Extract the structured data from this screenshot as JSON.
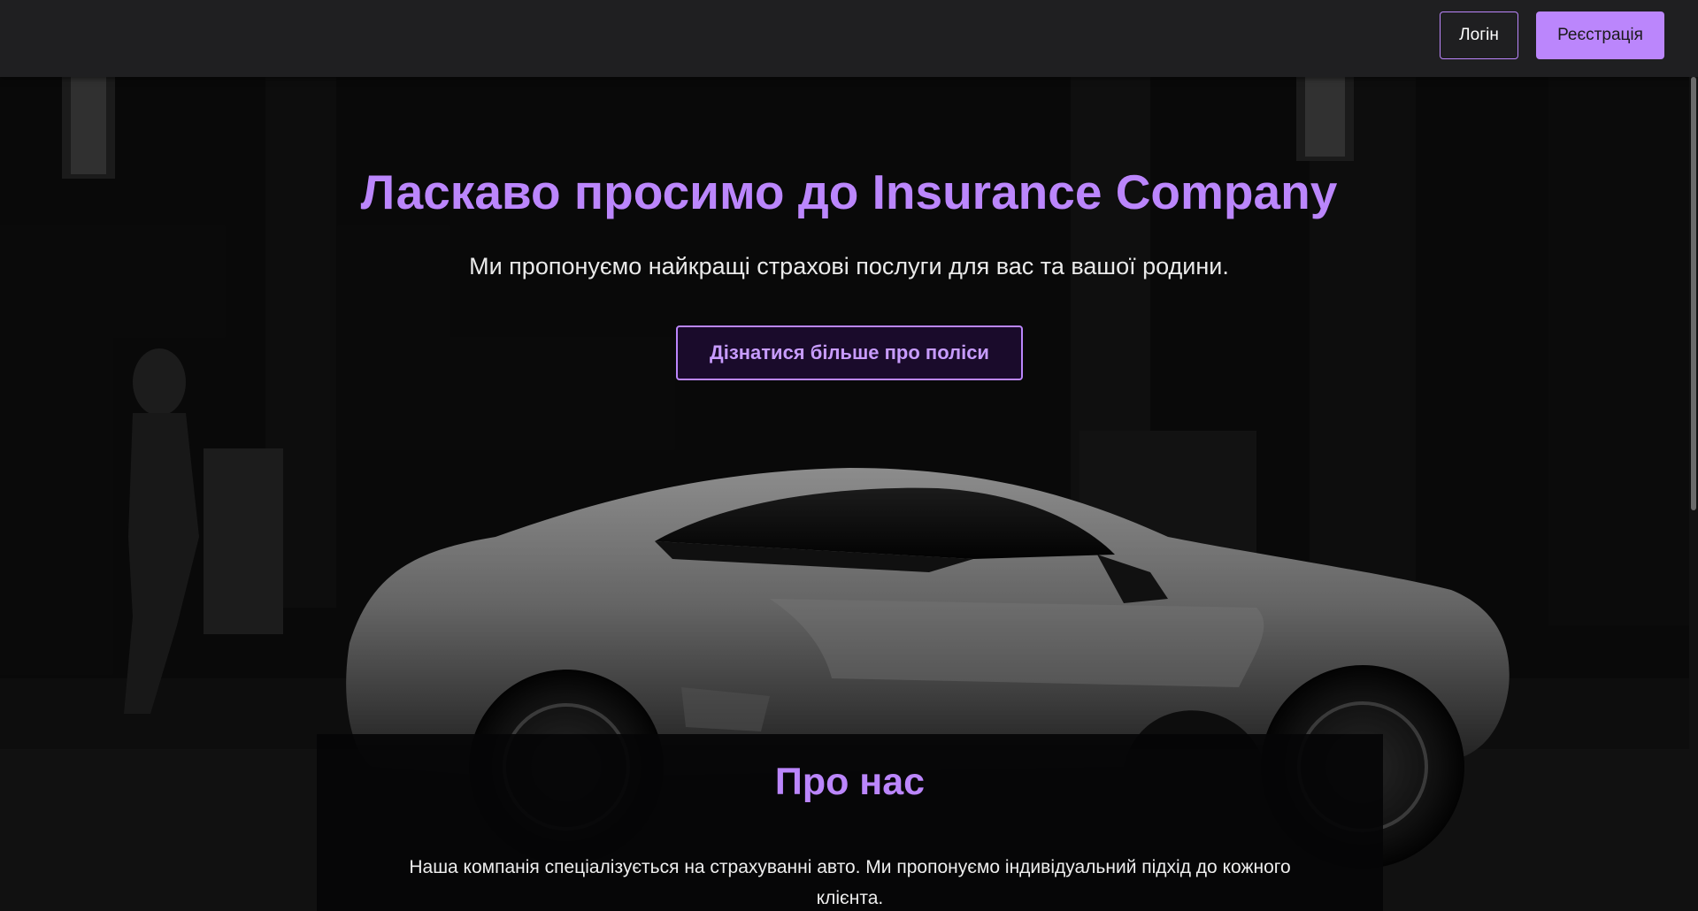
{
  "header": {
    "login_label": "Логін",
    "register_label": "Реєстрація"
  },
  "hero": {
    "title": "Ласкаво просимо до Insurance Company",
    "subtitle": "Ми пропонуємо найкращі страхові послуги для вас та вашої родини.",
    "cta_label": "Дізнатися більше про поліси"
  },
  "about": {
    "title": "Про нас",
    "text": "Наша компанія спеціалізується на страхуванні авто. Ми пропонуємо індивідуальний підхід до кожного клієнта."
  },
  "colors": {
    "accent": "#bb86fc",
    "topbar": "#1f1f21",
    "background": "#0b0b0c"
  }
}
